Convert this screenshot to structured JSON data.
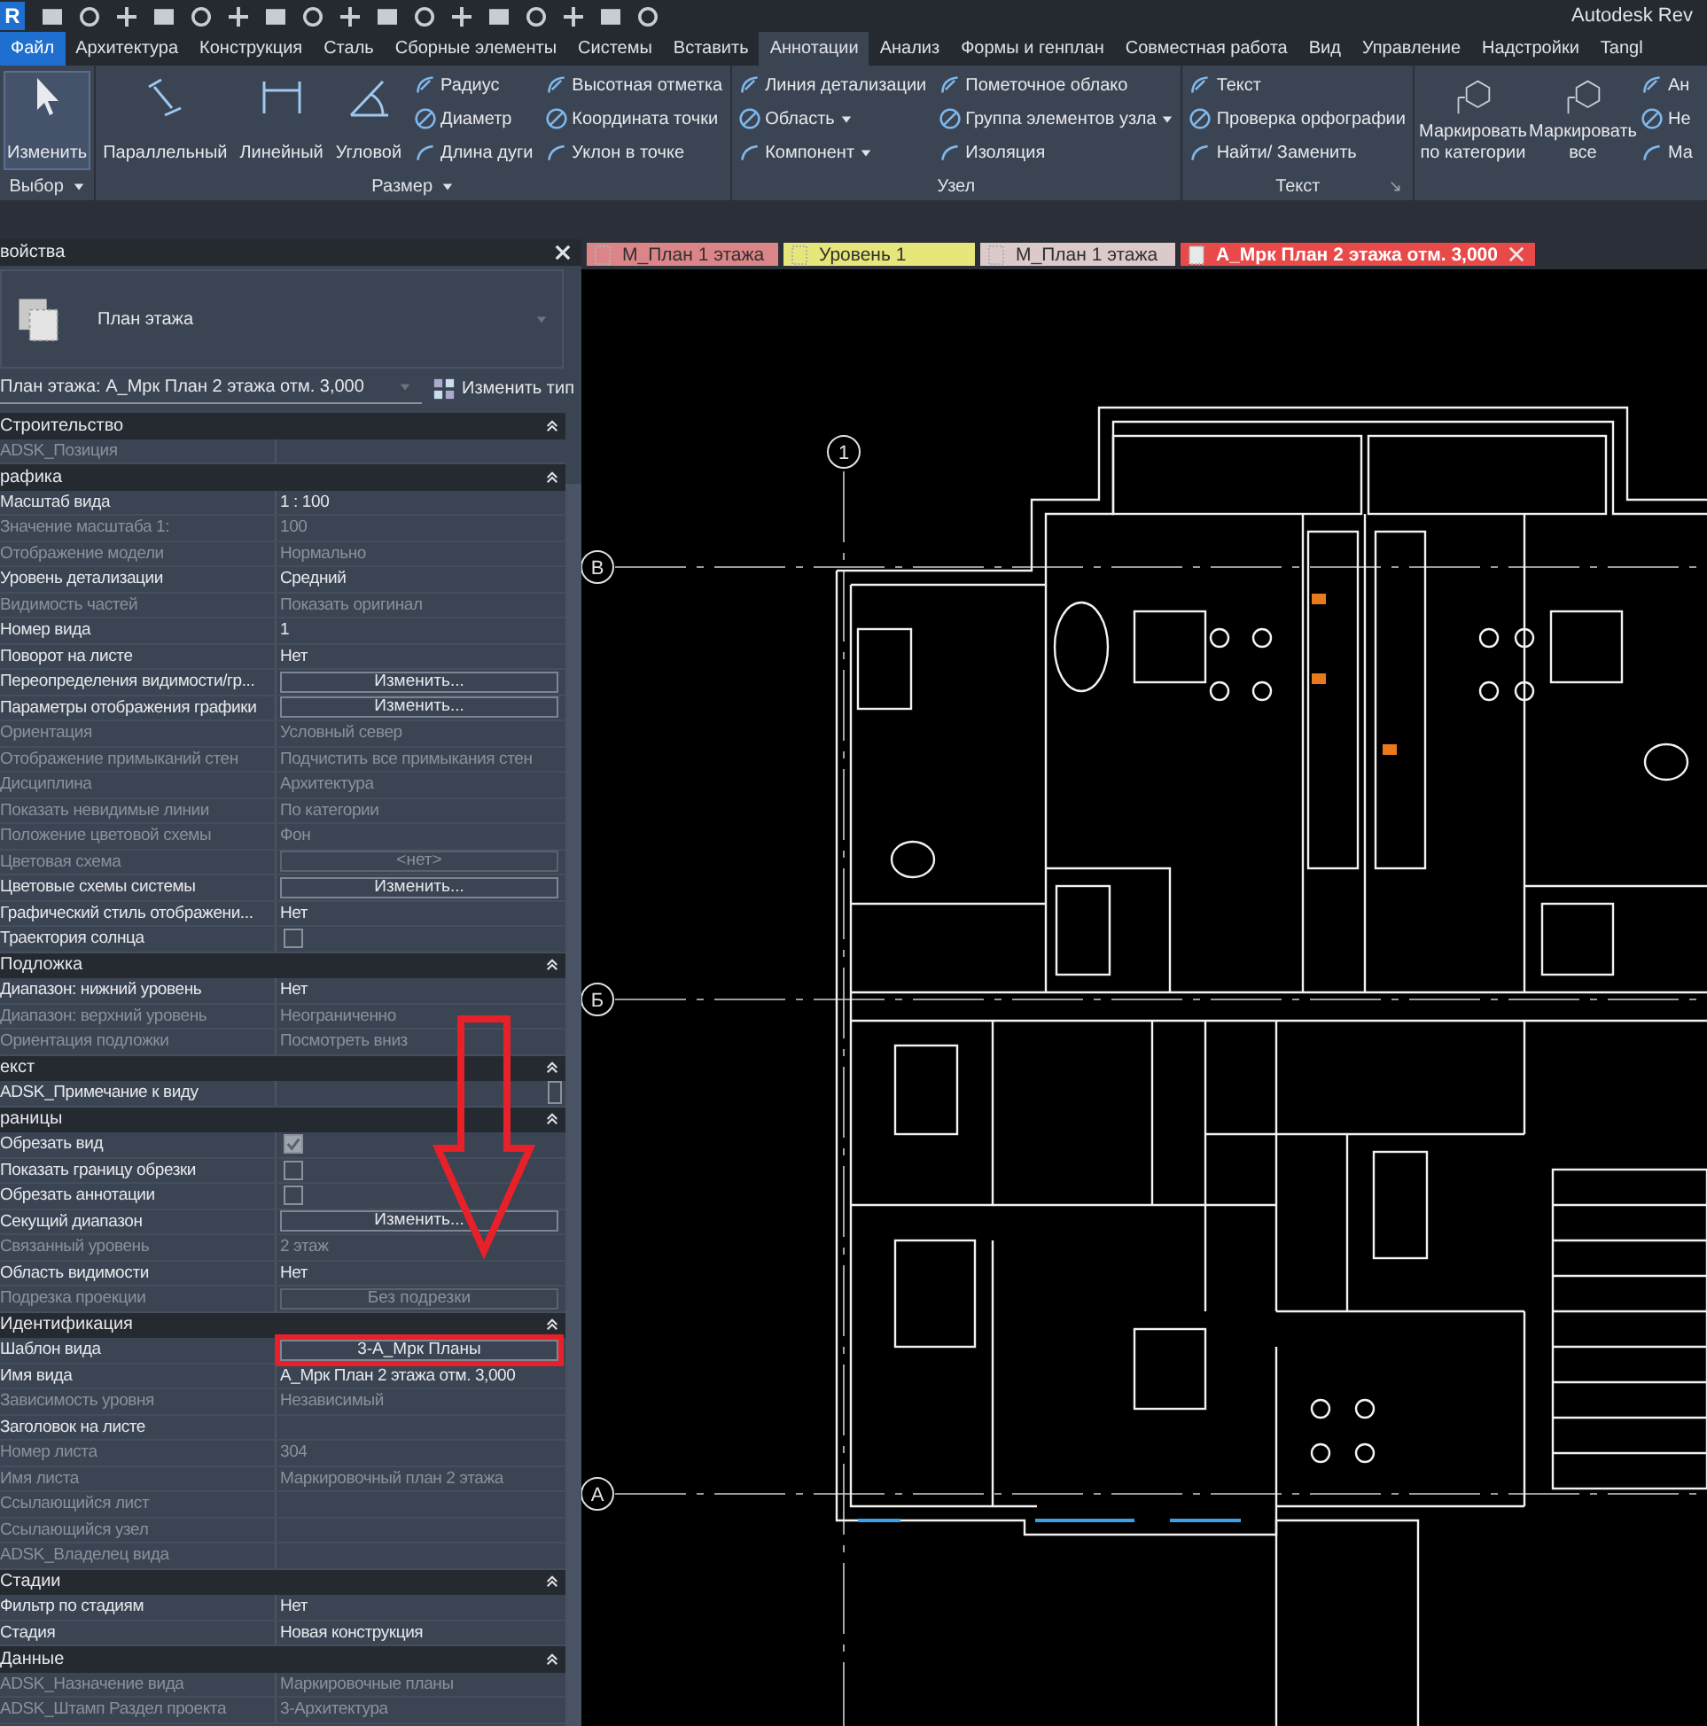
{
  "app": {
    "logo": "R",
    "title": "Autodesk Rev"
  },
  "ribbon_tabs": [
    {
      "label": "Файл",
      "kind": "application",
      "selected": false
    },
    {
      "label": "Архитектура",
      "kind": "tab",
      "selected": false
    },
    {
      "label": "Конструкция",
      "kind": "tab",
      "selected": false
    },
    {
      "label": "Сталь",
      "kind": "tab",
      "selected": false
    },
    {
      "label": "Сборные элементы",
      "kind": "tab",
      "selected": false
    },
    {
      "label": "Системы",
      "kind": "tab",
      "selected": false
    },
    {
      "label": "Вставить",
      "kind": "tab",
      "selected": false
    },
    {
      "label": "Аннотации",
      "kind": "tab",
      "selected": true
    },
    {
      "label": "Анализ",
      "kind": "tab",
      "selected": false
    },
    {
      "label": "Формы и генплан",
      "kind": "tab",
      "selected": false
    },
    {
      "label": "Совместная работа",
      "kind": "tab",
      "selected": false
    },
    {
      "label": "Вид",
      "kind": "tab",
      "selected": false
    },
    {
      "label": "Управление",
      "kind": "tab",
      "selected": false
    },
    {
      "label": "Надстройки",
      "kind": "tab",
      "selected": false
    },
    {
      "label": "Tangl",
      "kind": "tab",
      "selected": false
    }
  ],
  "ribbon_panels": [
    {
      "title": "Выбор",
      "dropdown": true,
      "big_buttons": [
        {
          "label": "Изменить",
          "active": true
        }
      ]
    },
    {
      "title": "Размер",
      "dropdown": true,
      "big_buttons": [
        {
          "label": "Параллельный",
          "active": false
        },
        {
          "label": "Линейный",
          "active": false
        },
        {
          "label": "Угловой",
          "active": false
        }
      ],
      "small_columns": [
        [
          {
            "label": "Радиус"
          },
          {
            "label": "Диаметр"
          },
          {
            "label": "Длина дуги"
          }
        ],
        [
          {
            "label": "Высотная отметка"
          },
          {
            "label": "Координата точки"
          },
          {
            "label": "Уклон  в точке"
          }
        ]
      ]
    },
    {
      "title": "Узел",
      "small_columns": [
        [
          {
            "label": "Линия детализации"
          },
          {
            "label": "Область",
            "dropdown": true
          },
          {
            "label": "Компонент",
            "dropdown": true
          }
        ],
        [
          {
            "label": "Пометочное облако"
          },
          {
            "label": "Группа элементов узла",
            "dropdown": true
          },
          {
            "label": "Изоляция"
          }
        ]
      ]
    },
    {
      "title": "Текст",
      "launcher": true,
      "small_columns": [
        [
          {
            "label": "Текст"
          },
          {
            "label": "Проверка  орфографии"
          },
          {
            "label": "Найти/ Заменить"
          }
        ]
      ]
    },
    {
      "big_buttons": [
        {
          "label": "Маркировать по категории",
          "active": false
        },
        {
          "label": "Маркировать все",
          "active": false
        }
      ],
      "small_columns": [
        [
          {
            "label": "Ан"
          },
          {
            "label": "Не"
          },
          {
            "label": "Ма"
          }
        ]
      ]
    }
  ],
  "properties": {
    "title": "войства",
    "type_name": "План этажа",
    "instance": "План этажа: А_Мрк План 2 этажа отм. 3,000",
    "edit_type": "Изменить тип",
    "groups": [
      {
        "title": "Строительство",
        "expanded": true,
        "rows": [
          {
            "label": "ADSK_Позиция",
            "kind": "empty",
            "disabled": true
          }
        ]
      },
      {
        "title": "рафика",
        "expanded": true,
        "rows": [
          {
            "label": "Масштаб вида",
            "kind": "text",
            "value": "1 : 100",
            "disabled": false
          },
          {
            "label": "Значение масштаба    1:",
            "kind": "text",
            "value": "100",
            "disabled": true
          },
          {
            "label": "Отображение модели",
            "kind": "text",
            "value": "Нормально",
            "disabled": true
          },
          {
            "label": "Уровень детализации",
            "kind": "text",
            "value": "Средний",
            "disabled": false
          },
          {
            "label": "Видимость частей",
            "kind": "text",
            "value": "Показать оригинал",
            "disabled": true
          },
          {
            "label": "Номер вида",
            "kind": "text",
            "value": "1",
            "disabled": false
          },
          {
            "label": "Поворот на листе",
            "kind": "text",
            "value": "Нет",
            "disabled": false
          },
          {
            "label": "Переопределения видимости/гр...",
            "kind": "button",
            "value": "Изменить...",
            "disabled": false
          },
          {
            "label": "Параметры отображения графики",
            "kind": "button",
            "value": "Изменить...",
            "disabled": false
          },
          {
            "label": "Ориентация",
            "kind": "text",
            "value": "Условный север",
            "disabled": true
          },
          {
            "label": "Отображение примыканий стен",
            "kind": "text",
            "value": "Подчистить все примыкания стен",
            "disabled": true
          },
          {
            "label": "Дисциплина",
            "kind": "text",
            "value": "Архитектура",
            "disabled": true
          },
          {
            "label": "Показать невидимые линии",
            "kind": "text",
            "value": "По категории",
            "disabled": true
          },
          {
            "label": "Положение цветовой схемы",
            "kind": "text",
            "value": "Фон",
            "disabled": true
          },
          {
            "label": "Цветовая схема",
            "kind": "button",
            "value": "<нет>",
            "disabled": true
          },
          {
            "label": "Цветовые схемы системы",
            "kind": "button",
            "value": "Изменить...",
            "disabled": false
          },
          {
            "label": "Графический стиль отображени...",
            "kind": "text",
            "value": "Нет",
            "disabled": false
          },
          {
            "label": "Траектория солнца",
            "kind": "checkbox",
            "checked": false,
            "disabled": false
          }
        ]
      },
      {
        "title": "Подложка",
        "expanded": true,
        "rows": [
          {
            "label": "Диапазон: нижний уровень",
            "kind": "text",
            "value": "Нет",
            "disabled": false
          },
          {
            "label": "Диапазон: верхний уровень",
            "kind": "text",
            "value": "Неограниченно",
            "disabled": true
          },
          {
            "label": "Ориентация подложки",
            "kind": "text",
            "value": "Посмотреть вниз",
            "disabled": true
          }
        ]
      },
      {
        "title": "екст",
        "expanded": true,
        "rows": [
          {
            "label": "ADSK_Примечание к виду",
            "kind": "edit",
            "disabled": false
          }
        ]
      },
      {
        "title": "раницы",
        "expanded": true,
        "rows": [
          {
            "label": "Обрезать вид",
            "kind": "checkbox",
            "checked": true,
            "disabled": false
          },
          {
            "label": "Показать границу обрезки",
            "kind": "checkbox",
            "checked": false,
            "disabled": false
          },
          {
            "label": "Обрезать аннотации",
            "kind": "checkbox",
            "checked": false,
            "disabled": false
          },
          {
            "label": "Секущий диапазон",
            "kind": "button",
            "value": "Изменить...",
            "disabled": false
          },
          {
            "label": "Связанный уровень",
            "kind": "text",
            "value": "2 этаж",
            "disabled": true
          },
          {
            "label": "Область видимости",
            "kind": "text",
            "value": "Нет",
            "disabled": false
          },
          {
            "label": "Подрезка проекции",
            "kind": "button",
            "value": "Без подрезки",
            "disabled": true
          }
        ]
      },
      {
        "title": "Идентификация",
        "expanded": true,
        "rows": [
          {
            "label": "Шаблон вида",
            "kind": "button",
            "value": "3-А_Мрк Планы",
            "disabled": false,
            "highlighted": true
          },
          {
            "label": "Имя вида",
            "kind": "text",
            "value": "А_Мрк План 2 этажа отм. 3,000",
            "disabled": false
          },
          {
            "label": "Зависимость уровня",
            "kind": "text",
            "value": "Независимый",
            "disabled": true
          },
          {
            "label": "Заголовок на листе",
            "kind": "empty",
            "disabled": false
          },
          {
            "label": "Номер листа",
            "kind": "text",
            "value": "304",
            "disabled": true
          },
          {
            "label": "Имя листа",
            "kind": "text",
            "value": "Маркировочный план 2 этажа",
            "disabled": true
          },
          {
            "label": "Ссылающийся лист",
            "kind": "empty",
            "disabled": true
          },
          {
            "label": "Ссылающийся узел",
            "kind": "empty",
            "disabled": true
          },
          {
            "label": "ADSK_Владелец вида",
            "kind": "empty",
            "disabled": true
          }
        ]
      },
      {
        "title": "Стадии",
        "expanded": true,
        "rows": [
          {
            "label": "Фильтр по стадиям",
            "kind": "text",
            "value": "Нет",
            "disabled": false
          },
          {
            "label": "Стадия",
            "kind": "text",
            "value": "Новая конструкция",
            "disabled": false
          }
        ]
      },
      {
        "title": "Данные",
        "expanded": true,
        "rows": [
          {
            "label": "ADSK_Назначение вида",
            "kind": "text",
            "value": "Маркировочные планы",
            "disabled": true
          },
          {
            "label": "ADSK_Штамп Раздел проекта",
            "kind": "text",
            "value": "3-Архитектура",
            "disabled": true
          }
        ]
      }
    ]
  },
  "view_tabs": [
    {
      "label": "М_План 1 этажа",
      "color": "#dc8588",
      "selected": false
    },
    {
      "label": "Уровень 1",
      "color": "#e6e67a",
      "selected": false
    },
    {
      "label": "М_План 1 этажа",
      "color": "#dccaca",
      "selected": false
    },
    {
      "label": "А_Мрк План 2 этажа отм. 3,000",
      "color": "#e84a4a",
      "selected": true
    }
  ],
  "plan": {
    "vertical_grid": [
      "1"
    ],
    "horizontal_grid": [
      "В",
      "Б",
      "А"
    ]
  }
}
